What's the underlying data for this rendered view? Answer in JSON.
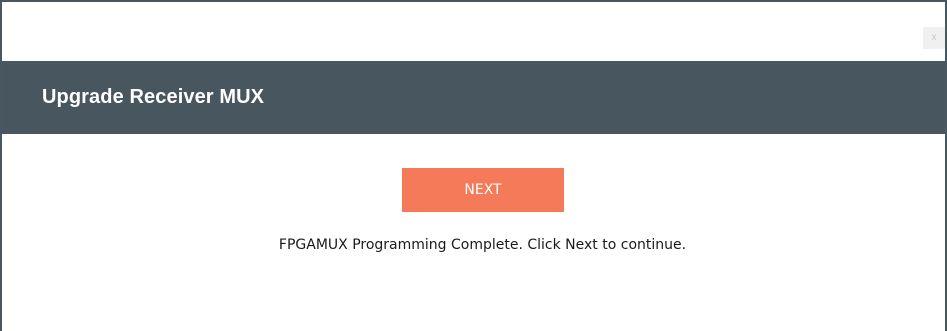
{
  "dialog": {
    "title": "Upgrade Receiver MUX",
    "close_label": "x"
  },
  "actions": {
    "next_label": "NEXT"
  },
  "status": {
    "message": "FPGAMUX Programming Complete. Click Next to continue."
  },
  "colors": {
    "header_bg": "#48565f",
    "next_button_bg": "#f47a5a",
    "border": "#4a5660"
  }
}
